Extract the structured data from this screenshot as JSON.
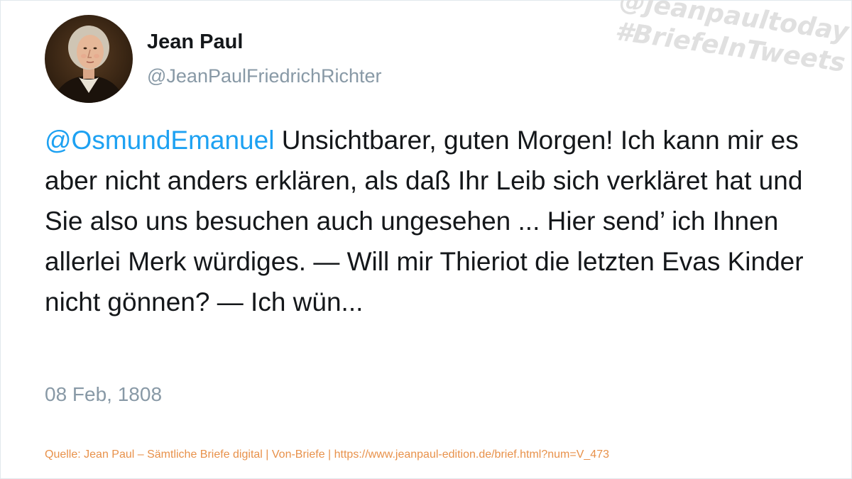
{
  "author": {
    "name": "Jean Paul",
    "handle": "@JeanPaulFriedrichRichter"
  },
  "watermark": {
    "line1": "@jeanpaultoday",
    "line2": "#BriefeInTweets"
  },
  "tweet": {
    "mention": "@OsmundEmanuel",
    "text": " Unsichtbarer, guten Morgen! Ich kann mir es aber nicht anders erklären, als daß Ihr Leib sich verkläret hat und Sie also uns besuchen auch ungesehen ... Hier send’ ich Ihnen allerlei Merk würdiges. — Will mir Thieriot die letzten Evas Kinder nicht gönnen? — Ich wün...",
    "date": "08 Feb, 1808"
  },
  "source": "Quelle: Jean Paul – Sämtliche Briefe digital | Von-Briefe | https://www.jeanpaul-edition.de/brief.html?num=V_473",
  "colors": {
    "mention": "#1da1f2",
    "handle": "#8899a6",
    "source": "#e8914a",
    "watermark": "#e0e0e0"
  }
}
